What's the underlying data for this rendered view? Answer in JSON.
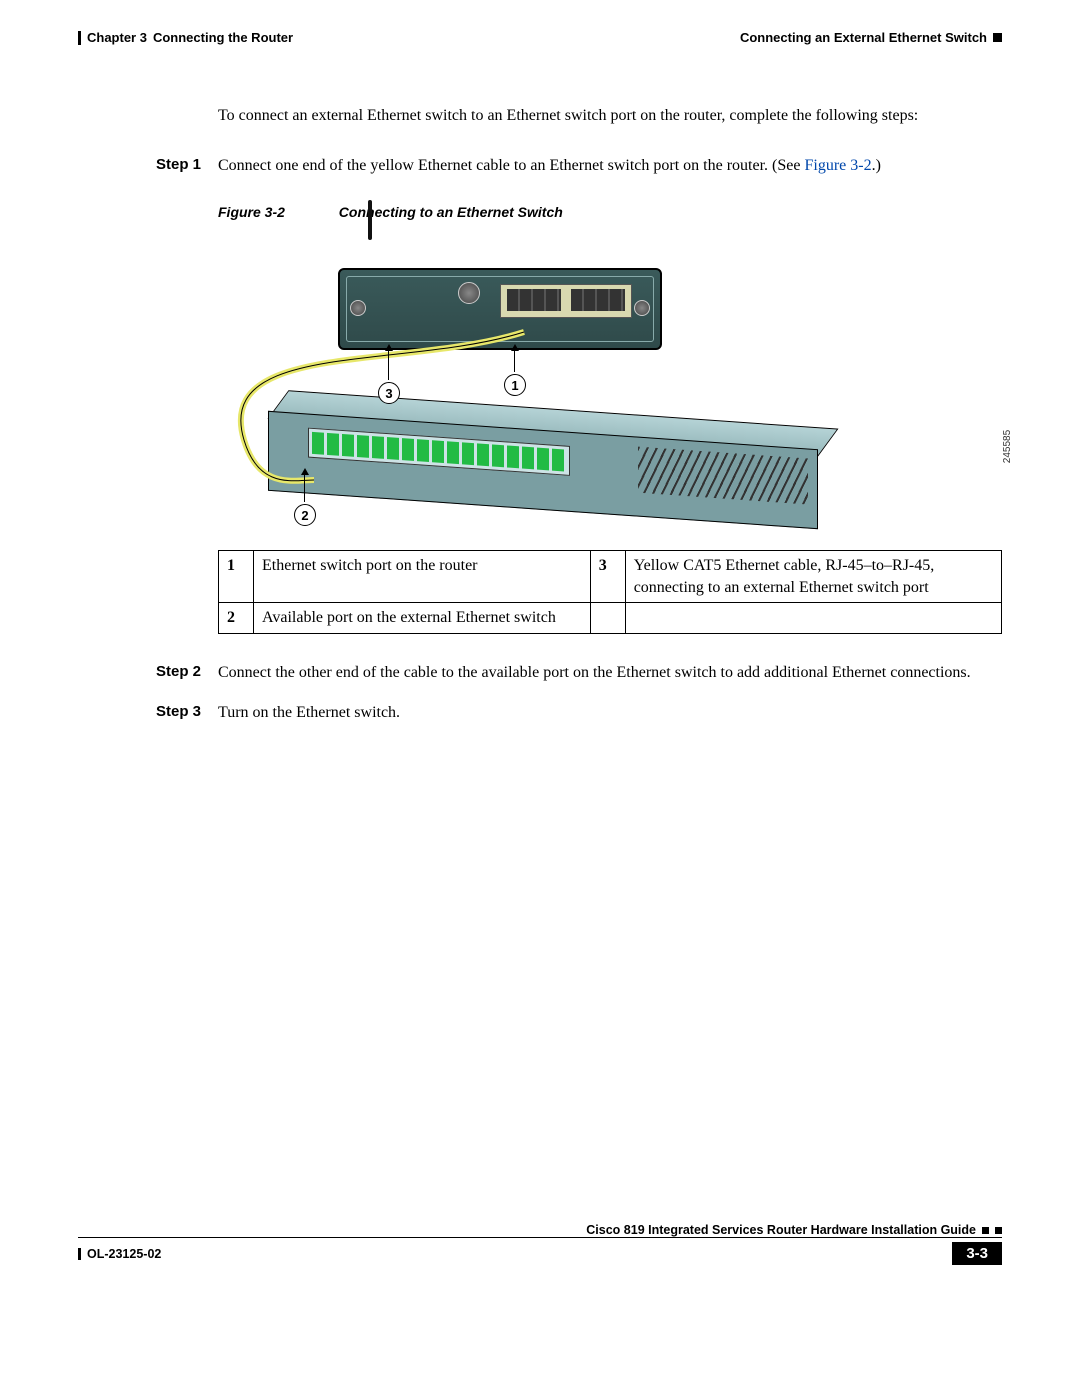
{
  "header": {
    "chapter_label": "Chapter 3",
    "chapter_title": "Connecting the Router",
    "section_title": "Connecting an External Ethernet Switch"
  },
  "intro": "To connect an external Ethernet switch to an Ethernet switch port on the router, complete the following steps:",
  "steps": [
    {
      "label": "Step 1",
      "text": "Connect one end of the yellow Ethernet cable to an Ethernet switch port on the router. (See ",
      "xref": "Figure 3-2",
      "text_after": ".)"
    },
    {
      "label": "Step 2",
      "text": "Connect the other end of the cable to the available port on the Ethernet switch to add additional Ethernet connections."
    },
    {
      "label": "Step 3",
      "text": "Turn on the Ethernet switch."
    }
  ],
  "figure": {
    "number": "Figure 3-2",
    "title": "Connecting to an Ethernet Switch",
    "image_number": "245585",
    "callouts": {
      "c1": "1",
      "c2": "2",
      "c3": "3"
    }
  },
  "legend": {
    "r1c1": "1",
    "r1c2": "Ethernet switch port on the router",
    "r1c3": "3",
    "r1c4": "Yellow CAT5 Ethernet cable, RJ-45–to–RJ-45, connecting to an external Ethernet switch port",
    "r2c1": "2",
    "r2c2": "Available port on the external Ethernet switch"
  },
  "footer": {
    "guide_title": "Cisco 819 Integrated Services Router Hardware Installation Guide",
    "doc_number": "OL-23125-02",
    "page_number": "3-3"
  }
}
